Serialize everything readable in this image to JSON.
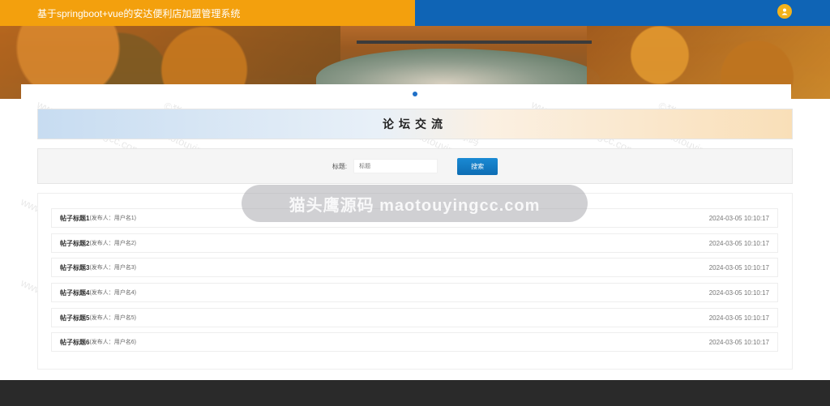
{
  "header": {
    "title": "基于springboot+vue的安达便利店加盟管理系统",
    "left_color": "#f3a00d",
    "right_color": "#0f64b5",
    "user_icon": "user-icon"
  },
  "banner": {
    "alt": "lake-and-autumn-forest",
    "active_dot": 1
  },
  "section": {
    "title": "论坛交流"
  },
  "search": {
    "label": "标题:",
    "placeholder": "标题",
    "button_label": "搜索"
  },
  "posts": [
    {
      "title": "帖子标题1",
      "author": "(发布人：用户名1)",
      "time": "2024-03-05 10:10:17"
    },
    {
      "title": "帖子标题2",
      "author": "(发布人：用户名2)",
      "time": "2024-03-05 10:10:17"
    },
    {
      "title": "帖子标题3",
      "author": "(发布人：用户名3)",
      "time": "2024-03-05 10:10:17"
    },
    {
      "title": "帖子标题4",
      "author": "(发布人：用户名4)",
      "time": "2024-03-05 10:10:17"
    },
    {
      "title": "帖子标题5",
      "author": "(发布人：用户名5)",
      "time": "2024-03-05 10:10:17"
    },
    {
      "title": "帖子标题6",
      "author": "(发布人：用户名6)",
      "time": "2024-03-05 10:10:17"
    }
  ],
  "watermark": {
    "text": "猫头鹰源码 maotouyingcc.com",
    "tile_1": "©猫头鹰源码",
    "tile_2": "www.maotouyingcc.com"
  }
}
